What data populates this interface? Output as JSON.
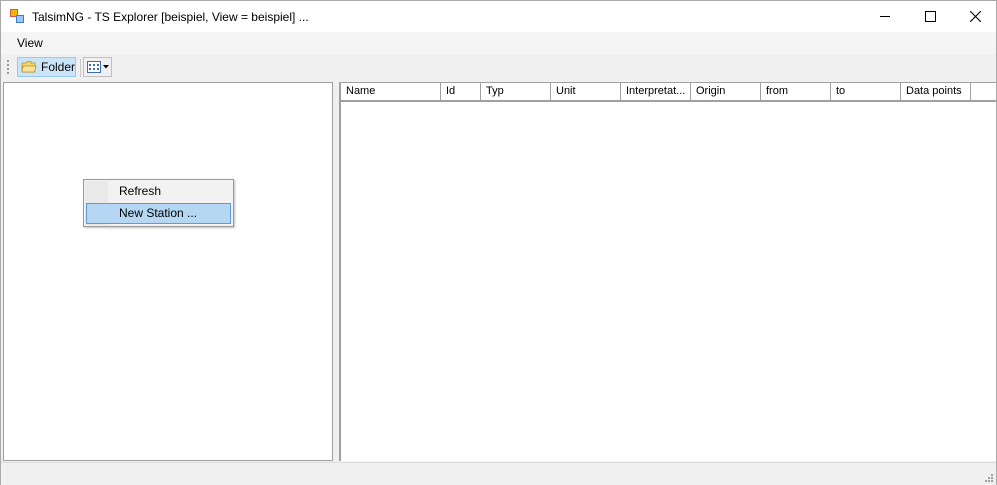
{
  "window": {
    "title": "TalsimNG - TS Explorer [beispiel, View = beispiel] ..."
  },
  "menubar": {
    "items": [
      {
        "label": "View"
      }
    ]
  },
  "toolbar": {
    "folder_label": "Folder"
  },
  "grid": {
    "columns": [
      {
        "label": "Name"
      },
      {
        "label": "Id"
      },
      {
        "label": "Typ"
      },
      {
        "label": "Unit"
      },
      {
        "label": "Interpretat..."
      },
      {
        "label": "Origin"
      },
      {
        "label": "from"
      },
      {
        "label": "to"
      },
      {
        "label": "Data points"
      }
    ]
  },
  "context_menu": {
    "items": [
      {
        "label": "Refresh",
        "selected": false
      },
      {
        "label": "New Station ...",
        "selected": true
      }
    ]
  },
  "icons": {
    "app": "app-icon",
    "minimize": "minimize-icon",
    "maximize": "maximize-icon",
    "close": "close-icon",
    "folder": "folder-icon",
    "view": "view-list-icon",
    "dropdown": "chevron-down-icon"
  },
  "colors": {
    "selection_bg": "#b5d7f3",
    "selection_border": "#5a9bd8",
    "toolbar_checked": "#cce4f7"
  }
}
